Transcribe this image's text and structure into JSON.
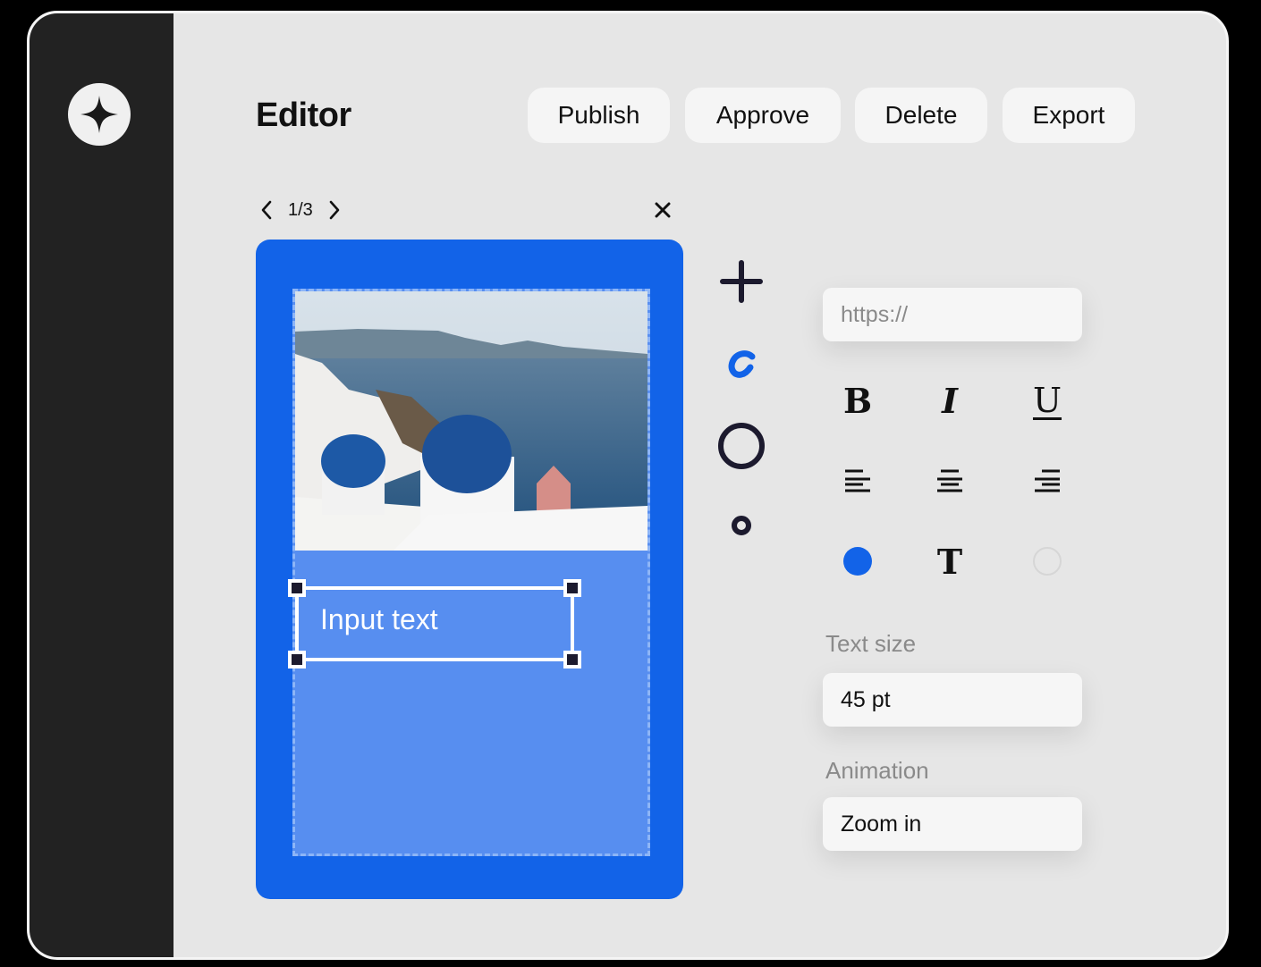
{
  "header": {
    "title": "Editor",
    "buttons": {
      "publish": "Publish",
      "approve": "Approve",
      "delete": "Delete",
      "export": "Export"
    }
  },
  "pager": {
    "current": 1,
    "total": 3,
    "label": "1/3"
  },
  "canvas": {
    "background_color": "#1263e8",
    "frame_color": "#578ef0",
    "text_placeholder": "Input text",
    "image_description": "Santorini coastline with blue-domed churches"
  },
  "tools": [
    "add-icon",
    "link-icon",
    "circle-shape-icon",
    "point-icon"
  ],
  "properties": {
    "url_placeholder": "https://",
    "format": {
      "bold": "B",
      "italic": "I",
      "underline": "U",
      "text_style": "T"
    },
    "alignment": [
      "align-left",
      "align-center",
      "align-right"
    ],
    "fill_color": "#1263e8",
    "text_size_label": "Text size",
    "text_size_value": "45 pt",
    "animation_label": "Animation",
    "animation_value": "Zoom in"
  }
}
